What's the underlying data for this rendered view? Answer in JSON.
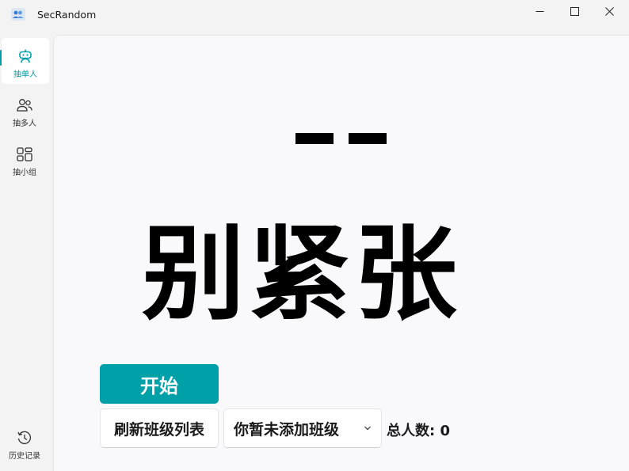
{
  "window": {
    "title": "SecRandom"
  },
  "sidebar": {
    "items": [
      {
        "label": "抽单人",
        "icon": "robot-icon",
        "selected": true
      },
      {
        "label": "抽多人",
        "icon": "people-icon",
        "selected": false
      },
      {
        "label": "抽小组",
        "icon": "apps-icon",
        "selected": false
      }
    ],
    "history": {
      "label": "历史记录",
      "icon": "history-icon"
    }
  },
  "main": {
    "placeholder_dashes": "— —",
    "message": "别紧张",
    "start_label": "开始",
    "refresh_label": "刷新班级列表",
    "class_select_value": "你暂未添加班级",
    "total_text": "总人数: 0"
  },
  "colors": {
    "accent": "#00a0a8",
    "background": "#f3f3f3",
    "content_background": "#f9f9fb"
  }
}
